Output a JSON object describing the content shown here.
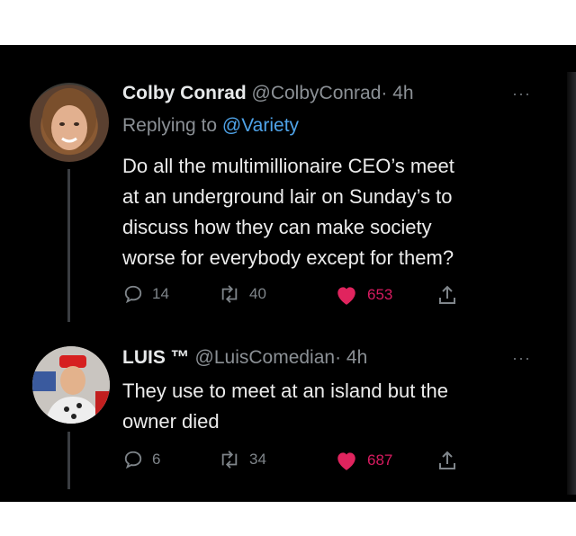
{
  "tweets": [
    {
      "name": "Colby Conrad",
      "handle": "@ColbyConrad",
      "time": "· 4h",
      "replying_label": "Replying to",
      "replying_handle": "@Variety",
      "text_lines": [
        "Do all the multimillionaire CEO’s meet",
        "at an underground lair on Sunday’s to",
        "discuss how they can make society",
        "worse for everybody except for them?"
      ],
      "replies": "14",
      "retweets": "40",
      "likes": "653",
      "more": "···"
    },
    {
      "name": "LUIS ™",
      "handle": "@LuisComedian",
      "time": "· 4h",
      "text_lines": [
        "They use to meet at an island but the",
        "owner died"
      ],
      "replies": "6",
      "retweets": "34",
      "likes": "687",
      "more": "···"
    }
  ],
  "colors": {
    "like": "#e0245e",
    "link": "#4fa3e8",
    "muted": "#71767b",
    "text": "#e7e9ea"
  },
  "icons": [
    "reply-icon",
    "retweet-icon",
    "like-icon",
    "share-icon"
  ]
}
